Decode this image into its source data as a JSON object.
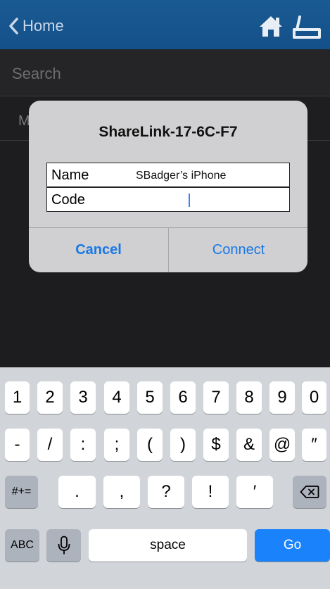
{
  "nav": {
    "back_label": "Home",
    "icons": [
      "chevron-left-icon",
      "home-icon",
      "printer-icon"
    ],
    "bar_color": "#14508a"
  },
  "background_list": {
    "search_label": "Search",
    "row_label_partial": "M"
  },
  "dialog": {
    "title": "ShareLink-17-6C-F7",
    "name_label": "Name",
    "name_value": "SBadger’s iPhone",
    "code_label": "Code",
    "code_value": "",
    "cancel_label": "Cancel",
    "connect_label": "Connect",
    "accent": "#1978e5"
  },
  "keyboard": {
    "row1": [
      "1",
      "2",
      "3",
      "4",
      "5",
      "6",
      "7",
      "8",
      "9",
      "0"
    ],
    "row2": [
      "-",
      "/",
      ":",
      ";",
      "(",
      ")",
      "$",
      "&",
      "@",
      "″"
    ],
    "mode_key": "#+=",
    "row3": [
      ".",
      ",",
      "?",
      "!",
      "′"
    ],
    "abc_key": "ABC",
    "space_key": "space",
    "go_key": "Go",
    "icons": [
      "delete-icon",
      "microphone-icon"
    ]
  }
}
